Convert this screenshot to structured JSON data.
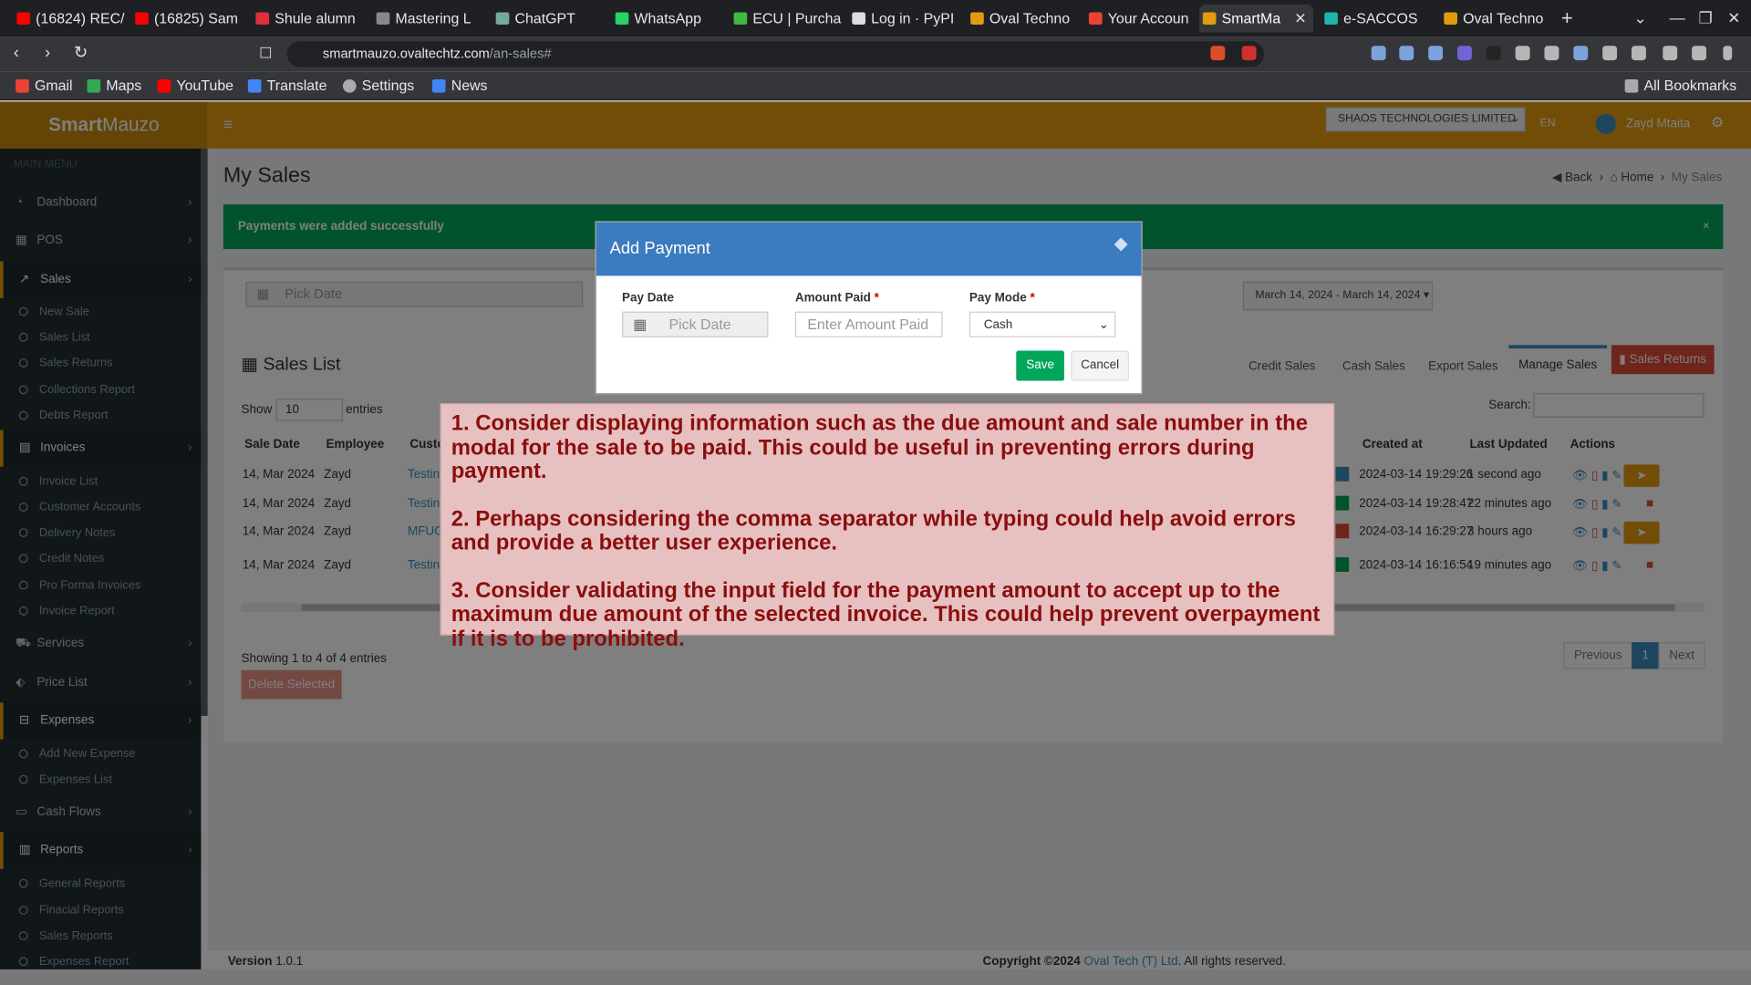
{
  "browser": {
    "tabs": [
      {
        "label": "(16824) REC/",
        "color": "#ff0000"
      },
      {
        "label": "(16825) Sam",
        "color": "#ff0000"
      },
      {
        "label": "Shule alumn",
        "color": "#e0303c"
      },
      {
        "label": "Mastering L",
        "color": "#cccccc"
      },
      {
        "label": "ChatGPT",
        "color": "#74aa9c"
      },
      {
        "label": "WhatsApp",
        "color": "#25d366"
      },
      {
        "label": "ECU | Purcha",
        "color": "#3fba3f"
      },
      {
        "label": "Log in · PyPI",
        "color": "#dddddd"
      },
      {
        "label": "Oval Techno",
        "color": "#e39b0e"
      },
      {
        "label": "Your Accoun",
        "color": "#ea4335"
      },
      {
        "label": "SmartMa",
        "color": "#e39b0e"
      },
      {
        "label": "e-SACCOS",
        "color": "#1fb5ac"
      },
      {
        "label": "Oval Techno",
        "color": "#e39b0e"
      }
    ],
    "url_host": "smartmauzo.ovaltechtz.com",
    "url_path": "/an-sales#",
    "bookmarks": [
      "Gmail",
      "Maps",
      "YouTube",
      "Translate",
      "Settings",
      "News"
    ],
    "all_bookmarks": "All Bookmarks"
  },
  "app": {
    "brand_bold": "Smart",
    "brand_rest": "Mauzo",
    "company": "SHAOS TECHNOLOGIES LIMITED",
    "lang": "EN",
    "user": "Zayd Mtaita"
  },
  "sidebar": {
    "header": "MAIN MENU",
    "items": {
      "dashboard": "Dashboard",
      "pos": "POS",
      "sales": "Sales",
      "invoices": "Invoices",
      "services": "Services",
      "price_list": "Price List",
      "expenses": "Expenses",
      "cash_flows": "Cash Flows",
      "reports": "Reports"
    },
    "sales_sub": [
      "New Sale",
      "Sales List",
      "Sales Returns",
      "Collections Report",
      "Debts Report"
    ],
    "invoices_sub": [
      "Invoice List",
      "Customer Accounts",
      "Delivery Notes",
      "Credit Notes",
      "Pro Forma Invoices",
      "Invoice Report"
    ],
    "expenses_sub": [
      "Add New Expense",
      "Expenses List"
    ],
    "reports_sub": [
      "General Reports",
      "Finacial Reports",
      "Sales Reports",
      "Expenses Report"
    ]
  },
  "page": {
    "title": "My Sales",
    "crumb_back": "Back",
    "crumb_home": "Home",
    "crumb_current": "My Sales",
    "alert": "Payments were added successfully",
    "pick_date": "Pick Date",
    "date_range": "March 14, 2024 - March 14, 2024",
    "list_title": "Sales List",
    "tabs": [
      "Credit Sales",
      "Cash Sales",
      "Export Sales",
      "Manage Sales"
    ],
    "returns_btn": "Sales Returns",
    "show": "Show",
    "entries_value": "10",
    "entries": "entries",
    "search": "Search:",
    "columns": {
      "sale_date": "Sale Date",
      "employee": "Employee",
      "customer": "Custo",
      "created": "Created at",
      "updated": "Last Updated",
      "actions": "Actions"
    },
    "rows": [
      {
        "date": "14, Mar 2024",
        "emp": "Zayd",
        "cust": "Testin",
        "created": "2024-03-14 19:29:26",
        "updated": "1 second ago",
        "status_color": "#3c8dbc"
      },
      {
        "date": "14, Mar 2024",
        "emp": "Zayd",
        "cust": "Testin",
        "created": "2024-03-14 19:28:47",
        "updated": "22 minutes ago",
        "status_color": "#00a65a"
      },
      {
        "date": "14, Mar 2024",
        "emp": "Zayd",
        "cust": "MFUG",
        "created": "2024-03-14 16:29:27",
        "updated": "3 hours ago",
        "status_color": "#dd4b39"
      },
      {
        "date": "14, Mar 2024",
        "emp": "Zayd",
        "cust": "Testin",
        "created": "2024-03-14 16:16:54",
        "updated": "19 minutes ago",
        "status_color": "#00a65a"
      }
    ],
    "showing": "Showing 1 to 4 of 4 entries",
    "delete_selected": "Delete Selected",
    "pagination": {
      "prev": "Previous",
      "current": "1",
      "next": "Next"
    },
    "footer_version_label": "Version",
    "footer_version": "1.0.1",
    "footer_copy": "Copyright ©2024",
    "footer_company": "Oval Tech (T) Ltd",
    "footer_rights": ". All rights reserved."
  },
  "modal": {
    "title": "Add Payment",
    "pay_date_label": "Pay Date",
    "pay_date_placeholder": "Pick Date",
    "amount_label": "Amount Paid",
    "amount_placeholder": "Enter Amount Paid",
    "mode_label": "Pay Mode",
    "mode_value": "Cash",
    "save": "Save",
    "cancel": "Cancel"
  },
  "annotation": {
    "point1": "1. Consider displaying information such as the due amount and sale number in the modal for the sale to be paid. This could be useful in preventing errors during payment.",
    "point2": "2. Perhaps considering the comma separator while typing could help avoid errors and provide a better user experience.",
    "point3": "3. Consider validating the input field for the payment amount to accept up to the maximum due amount of the selected invoice. This could help prevent overpayment if it is to be prohibited."
  }
}
